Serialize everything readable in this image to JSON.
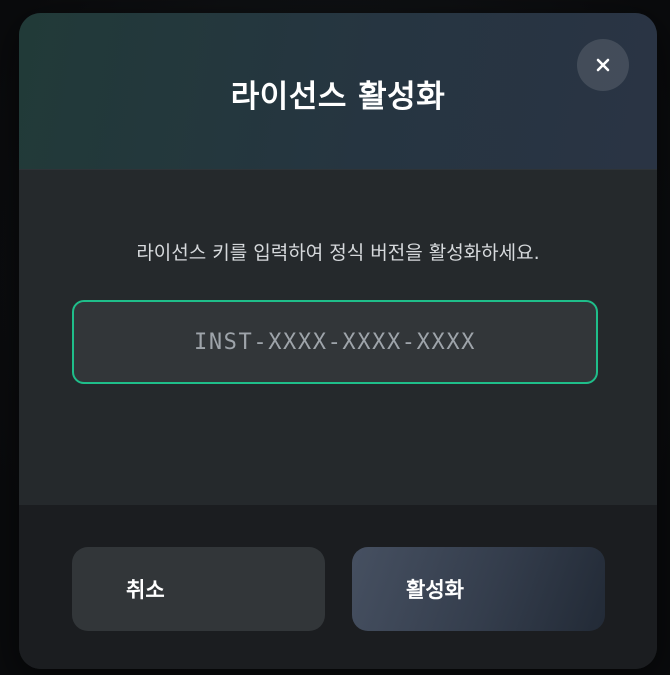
{
  "dialog": {
    "title": "라이선스 활성화",
    "close_icon": "close-icon",
    "description": "라이선스 키를 입력하여 정식 버전을 활성화하세요.",
    "license_input": {
      "value": "",
      "placeholder": "INST-XXXX-XXXX-XXXX"
    },
    "cancel_label": "취소",
    "activate_label": "활성화"
  },
  "colors": {
    "accent_border": "#1fbe8a",
    "dialog_bg": "#202326"
  }
}
